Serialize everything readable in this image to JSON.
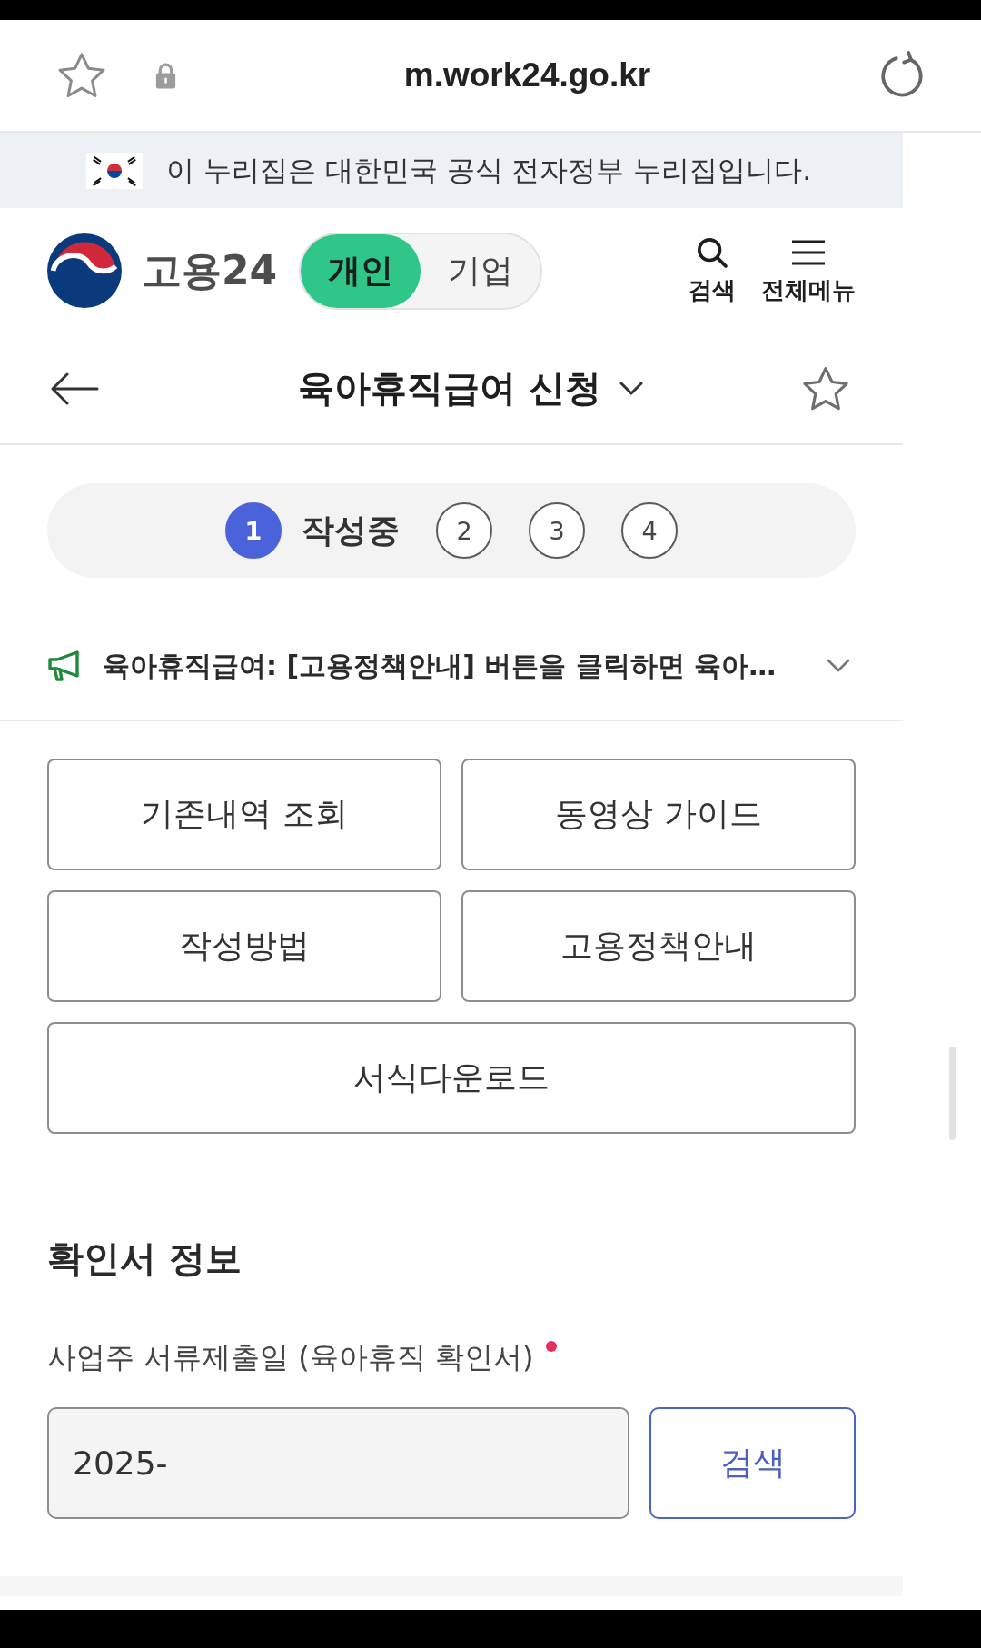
{
  "browser_bar": {
    "url": "m.work24.go.kr"
  },
  "gov_banner": {
    "text": "이 누리집은 대한민국 공식 전자정부 누리집입니다."
  },
  "header": {
    "logo_text": "고용24",
    "user_types": [
      {
        "label": "개인",
        "selected": true
      },
      {
        "label": "기업",
        "selected": false
      }
    ],
    "actions": [
      {
        "kind": "search",
        "label": "검색"
      },
      {
        "kind": "menu",
        "label": "전체메뉴"
      }
    ]
  },
  "title_bar": {
    "title": "육아휴직급여 신청"
  },
  "steps": [
    {
      "number": "1",
      "label": "작성중",
      "selected": true
    },
    {
      "number": "2",
      "selected": false
    },
    {
      "number": "3",
      "selected": false
    },
    {
      "number": "4",
      "selected": false
    }
  ],
  "notice": {
    "text": "육아휴직급여: [고용정책안내] 버튼을 클릭하면 육아…"
  },
  "buttons": [
    "기존내역 조회",
    "동영상 가이드",
    "작성방법",
    "고용정책안내",
    "서식다운로드"
  ],
  "section": {
    "title": "확인서 정보",
    "field": {
      "label": "사업주 서류제출일 (육아휴직 확인서)",
      "required": true,
      "value": "2025-",
      "button": "검색"
    }
  }
}
